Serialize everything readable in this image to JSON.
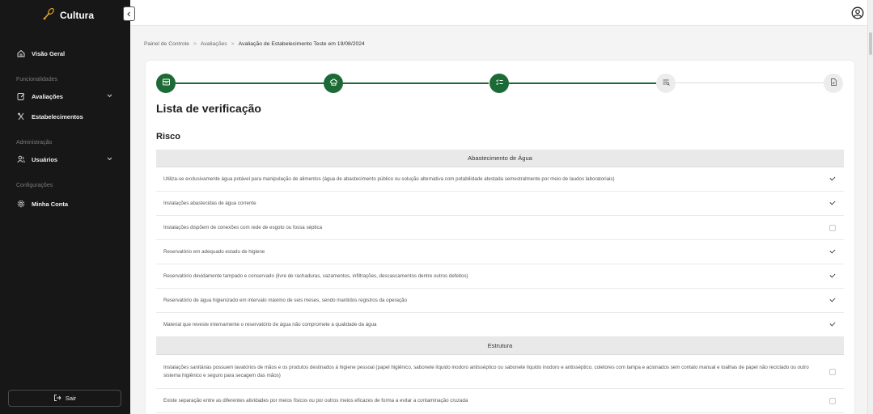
{
  "app": {
    "brand_name": "Cultura",
    "colors": {
      "sidebar_bg": "#171717",
      "accent_green": "#1c6b36",
      "step_todo": "#ececec"
    }
  },
  "sidebar": {
    "items": [
      {
        "label": "Visão Geral",
        "icon": "home-icon"
      },
      {
        "label": "Avaliações",
        "icon": "clipboard-edit-icon",
        "expandable": true
      },
      {
        "label": "Estabelecimentos",
        "icon": "utensils-icon"
      },
      {
        "label": "Usuários",
        "icon": "users-icon",
        "expandable": true
      },
      {
        "label": "Minha Conta",
        "icon": "gear-icon"
      }
    ],
    "sections": {
      "funcionalidades": "Funcionalidades",
      "administracao": "Administração",
      "configuracoes": "Configurações"
    },
    "logout_label": "Sair"
  },
  "breadcrumb": {
    "items": [
      "Painel de Controle",
      "Avaliações",
      "Avaliação de Estabelecimento Teste em 19/08/2024"
    ],
    "separator": ">"
  },
  "stepper": {
    "steps": [
      {
        "icon": "store-icon",
        "state": "done"
      },
      {
        "icon": "chef-hat-icon",
        "state": "done"
      },
      {
        "icon": "checklist-icon",
        "state": "active"
      },
      {
        "icon": "list-search-icon",
        "state": "todo"
      },
      {
        "icon": "document-icon",
        "state": "todo"
      }
    ]
  },
  "main": {
    "title": "Lista de verificação",
    "section_title": "Risco",
    "groups": [
      {
        "title": "Abastecimento de Água",
        "items": [
          {
            "text": "Utiliza-se exclusivamente água potável para manipulação de alimentos (água de abastecimento público ou solução alternativa com potabilidade atestada semestralmente por meio de laudos laboratoriais)",
            "checked": true
          },
          {
            "text": "Instalações abastecidas de água corrente",
            "checked": true
          },
          {
            "text": "Instalações dispõem de conexões com rede de esgoto ou fossa séptica",
            "checked": false
          },
          {
            "text": "Reservatório em adequado estado de higiene",
            "checked": true
          },
          {
            "text": "Reservatório devidamente tampado e conservado (livre de rachaduras, vazamentos, infiltrações, descascamentos dentre outros defeitos)",
            "checked": true
          },
          {
            "text": "Reservatório de água higienizado em intervalo máximo de seis meses, sendo mantidos registros da operação",
            "checked": true
          },
          {
            "text": "Material que reveste internamente o reservatório de água não compromete a qualidade da água",
            "checked": true
          }
        ]
      },
      {
        "title": "Estrutura",
        "items": [
          {
            "text": "Instalações sanitárias possuem lavatórios de mãos e os produtos destinados à higiene pessoal (papel higiênico, sabonete líquido inodoro antisséptico ou sabonete líquido inodoro e antisséptico, coletores com tampa e acionados sem contato manual e toalhas de papel não reciclado ou outro sistema higiênico e seguro para secagem das mãos)",
            "checked": false
          },
          {
            "text": "Existe separação entre as diferentes atividades por meios físicos ou por outros meios eficazes de forma a evitar a contaminação cruzada",
            "checked": false
          }
        ]
      }
    ]
  }
}
